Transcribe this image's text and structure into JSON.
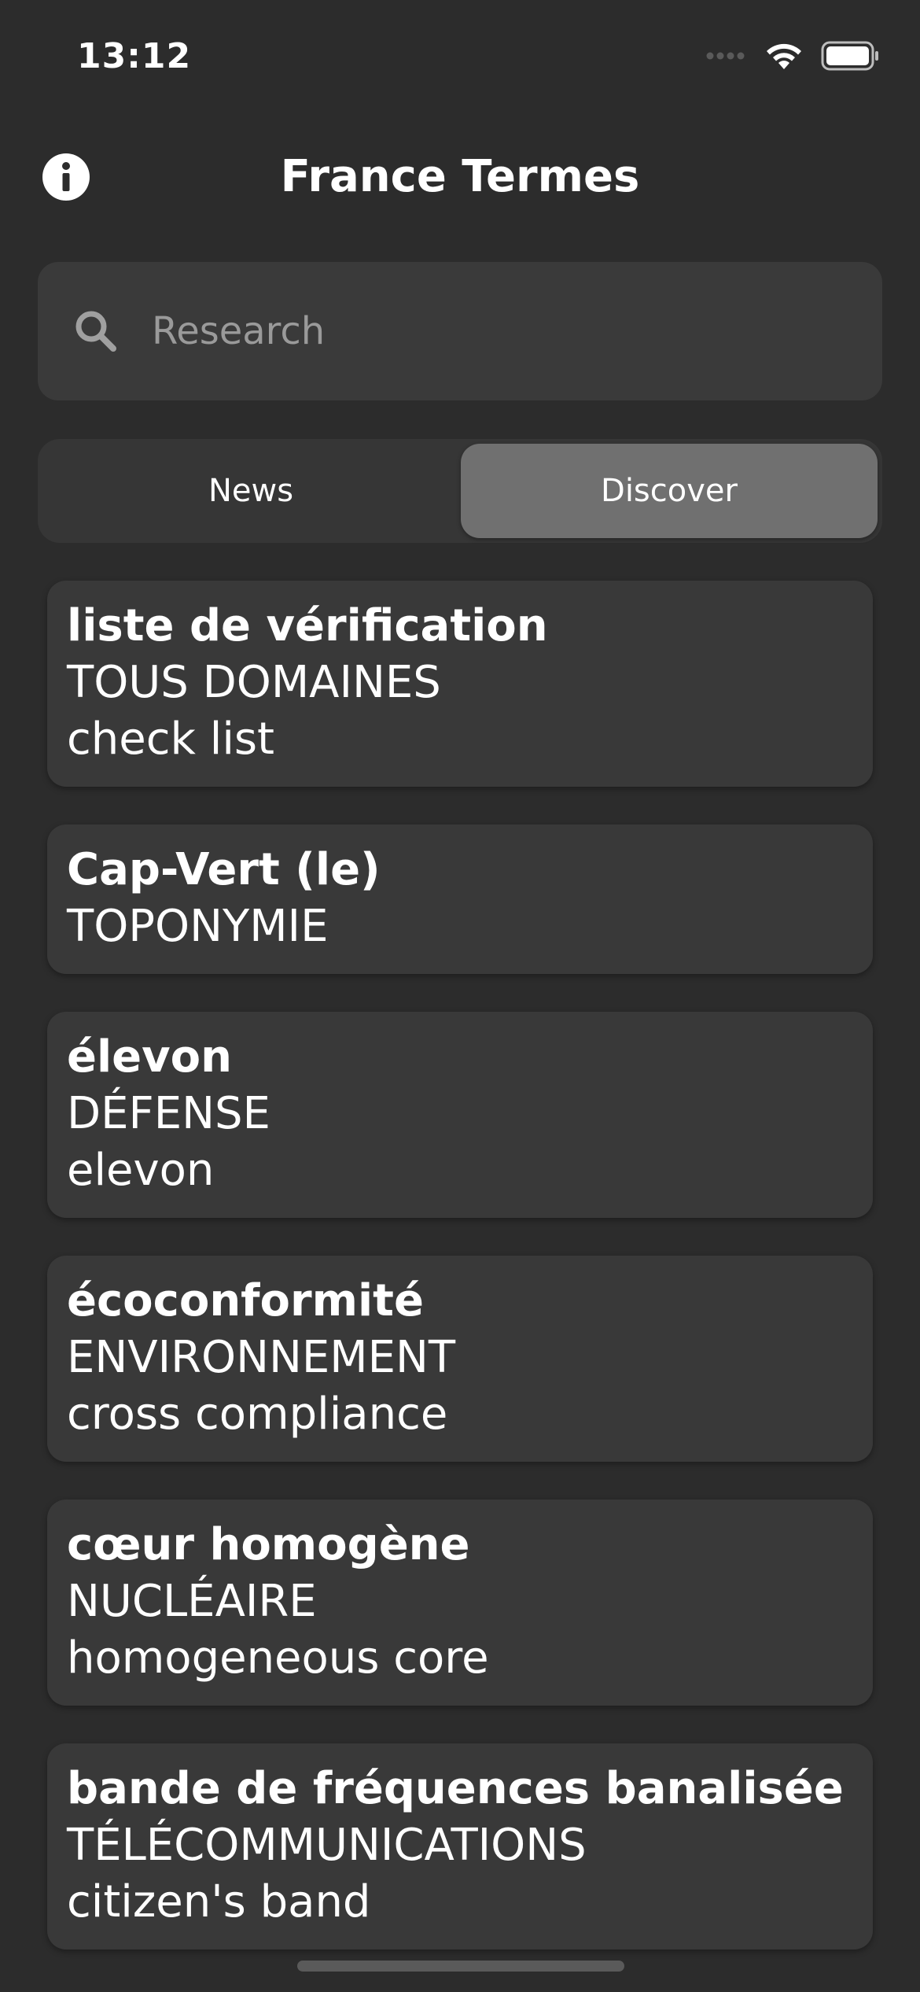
{
  "status_bar": {
    "time": "13:12"
  },
  "header": {
    "title": "France Termes",
    "info_icon": "info-circle-icon"
  },
  "search": {
    "placeholder": "Research",
    "value": "",
    "icon": "search-icon"
  },
  "tabs": [
    {
      "label": "News",
      "selected": false
    },
    {
      "label": "Discover",
      "selected": true
    }
  ],
  "entries": [
    {
      "term": "liste de vérification",
      "domain": "TOUS DOMAINES",
      "translation": "check list"
    },
    {
      "term": "Cap-Vert (le)",
      "domain": "TOPONYMIE",
      "translation": ""
    },
    {
      "term": "élevon",
      "domain": "DÉFENSE",
      "translation": "elevon"
    },
    {
      "term": "écoconformité",
      "domain": "ENVIRONNEMENT",
      "translation": "cross compliance"
    },
    {
      "term": "cœur homogène",
      "domain": "NUCLÉAIRE",
      "translation": "homogeneous core"
    },
    {
      "term": "bande de fréquences banalisée",
      "domain": "TÉLÉCOMMUNICATIONS",
      "translation": "citizen's band"
    }
  ],
  "colors": {
    "background": "#2c2c2c",
    "card": "#393939",
    "segment_selected": "#707070",
    "text": "#ffffff",
    "placeholder": "#9a9a9a"
  }
}
